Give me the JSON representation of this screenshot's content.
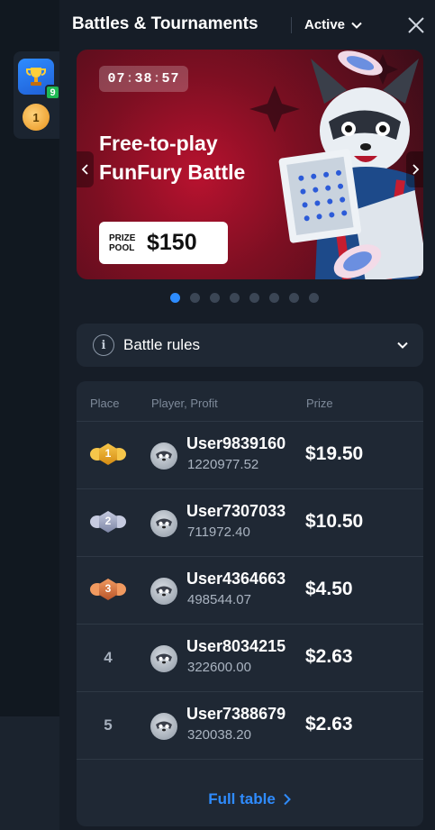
{
  "sidebar": {
    "items": [
      {
        "icon": "trophy-icon",
        "badge": "9"
      },
      {
        "icon": "medal-icon"
      }
    ]
  },
  "header": {
    "title": "Battles & Tournaments",
    "filter_label": "Active"
  },
  "banner": {
    "timer": {
      "h": "07",
      "m": "38",
      "s": "57"
    },
    "title_line1": "Free-to-play",
    "title_line2": "FunFury Battle",
    "prize_label_line1": "PRIZE",
    "prize_label_line2": "POOL",
    "prize_amount": "$150",
    "slides_total": 8,
    "active_slide": 1
  },
  "rules": {
    "label": "Battle rules"
  },
  "leaderboard": {
    "headers": {
      "place": "Place",
      "player": "Player, Profit",
      "prize": "Prize"
    },
    "rows": [
      {
        "place": "1",
        "medal": "gold",
        "user": "User9839160",
        "profit": "1220977.52",
        "prize": "$19.50"
      },
      {
        "place": "2",
        "medal": "silver",
        "user": "User7307033",
        "profit": "711972.40",
        "prize": "$10.50"
      },
      {
        "place": "3",
        "medal": "bronze",
        "user": "User4364663",
        "profit": "498544.07",
        "prize": "$4.50"
      },
      {
        "place": "4",
        "medal": "",
        "user": "User8034215",
        "profit": "322600.00",
        "prize": "$2.63"
      },
      {
        "place": "5",
        "medal": "",
        "user": "User7388679",
        "profit": "320038.20",
        "prize": "$2.63"
      }
    ],
    "full_table_label": "Full table"
  },
  "colors": {
    "accent": "#2d8cff",
    "gold": "#f2b631",
    "silver": "#a3a9c2",
    "bronze": "#e0814a"
  }
}
